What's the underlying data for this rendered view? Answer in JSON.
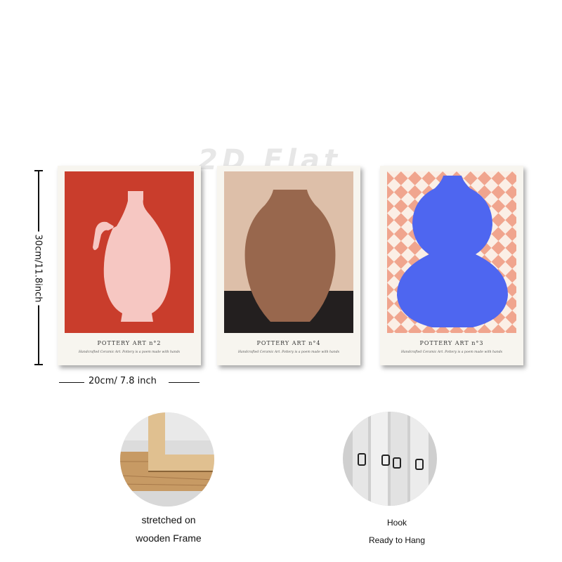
{
  "watermark": "2D Flat",
  "dimensions": {
    "height_label": "30cm/11.8inch",
    "width_label": "20cm/ 7.8 inch"
  },
  "posters": [
    {
      "title": "POTTERY ART n°2",
      "subtitle": "Handcrafted Ceramic Art. Pottery is a poem made with hands"
    },
    {
      "title": "POTTERY ART n°4",
      "subtitle": "Handcrafted Ceramic Art. Pottery is a poem made with hands"
    },
    {
      "title": "POTTERY ART n°3",
      "subtitle": "Handcrafted Ceramic Art. Pottery is a poem made with hands"
    }
  ],
  "features": [
    {
      "line1": "stretched on",
      "line2": "wooden Frame"
    },
    {
      "line1": "Hook",
      "line2": "Ready to Hang"
    }
  ],
  "colors": {
    "poster1_bg": "#c93d2c",
    "poster1_vase": "#f6c7c2",
    "poster2_bg": "#ddbfa9",
    "poster2_table": "#231f1f",
    "poster2_vase": "#98674d",
    "poster3_check_a": "#f0a58e",
    "poster3_check_b": "#fbefe6",
    "poster3_vase": "#4e66f0"
  }
}
